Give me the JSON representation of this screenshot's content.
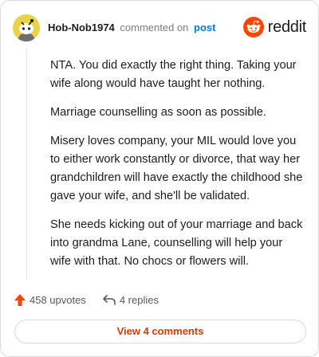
{
  "comment": {
    "author": "Hob-Nob1974",
    "meta_text": "commented on",
    "post_link": "post",
    "paragraphs": [
      "NTA. You did exactly the right thing. Taking your wife along would have taught her nothing.",
      "Marriage counselling as soon as possible.",
      "Misery loves company, your MIL would love you to either work constantly or divorce, that way her grandchildren will have exactly the childhood she gave your wife, and she'll be validated.",
      "She needs kicking out of your marriage and back into grandma Lane, counselling will help your wife with that. No chocs or flowers will."
    ]
  },
  "brand": {
    "name": "reddit",
    "icon": "reddit-snoo-icon",
    "color": "#ff4500"
  },
  "footer": {
    "upvotes_label": "458 upvotes",
    "replies_label": "4 replies",
    "view_comments_label": "View 4 comments",
    "upvote_icon": "upvote-arrow-icon",
    "reply_icon": "reply-arrow-icon",
    "accent": "#d93a00"
  }
}
